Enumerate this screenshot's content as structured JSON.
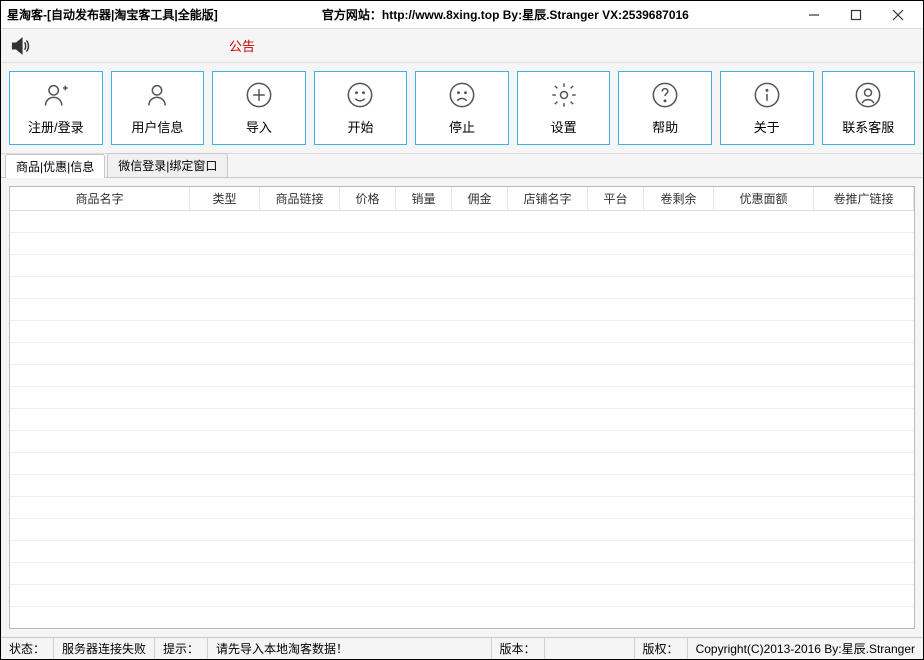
{
  "titlebar": {
    "app_title": "星淘客-[自动发布器|淘宝客工具|全能版]",
    "center_text": "官方网站：http://www.8xing.top    By:星辰.Stranger  VX:2539687016"
  },
  "notice": {
    "label": "公告"
  },
  "toolbar": [
    {
      "id": "register-login",
      "label": "注册/登录",
      "icon": "user-plus-icon"
    },
    {
      "id": "user-info",
      "label": "用户信息",
      "icon": "user-icon"
    },
    {
      "id": "import",
      "label": "导入",
      "icon": "plus-circle-icon"
    },
    {
      "id": "start",
      "label": "开始",
      "icon": "smile-icon"
    },
    {
      "id": "stop",
      "label": "停止",
      "icon": "sad-icon"
    },
    {
      "id": "settings",
      "label": "设置",
      "icon": "gear-icon"
    },
    {
      "id": "help",
      "label": "帮助",
      "icon": "question-circle-icon"
    },
    {
      "id": "about",
      "label": "关于",
      "icon": "info-circle-icon"
    },
    {
      "id": "contact",
      "label": "联系客服",
      "icon": "support-icon"
    }
  ],
  "tabs": [
    {
      "label": "商品|优惠|信息",
      "active": true
    },
    {
      "label": "微信登录|绑定窗口",
      "active": false
    }
  ],
  "grid": {
    "columns": [
      "商品名字",
      "类型",
      "商品链接",
      "价格",
      "销量",
      "佣金",
      "店铺名字",
      "平台",
      "卷剩余",
      "优惠面额",
      "卷推广链接"
    ]
  },
  "statusbar": {
    "status_label": "状态：",
    "status_value": "服务器连接失败",
    "hint_label": "提示：",
    "hint_value": "请先导入本地淘客数据！",
    "version_label": "版本：",
    "copyright_label": "版权：",
    "copyright_value": "Copyright(C)2013-2016 By:星辰.Stranger"
  }
}
